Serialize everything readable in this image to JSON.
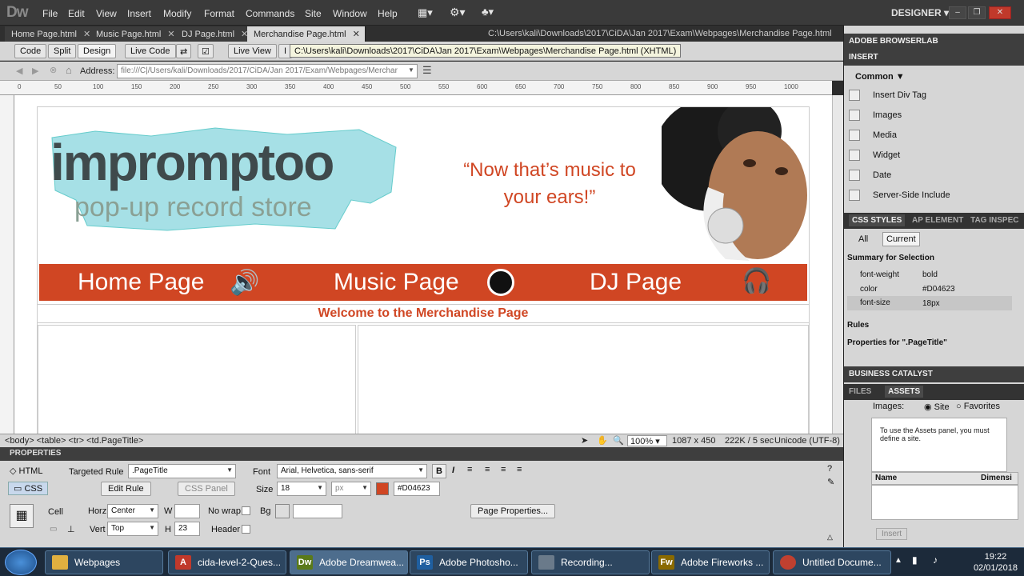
{
  "app": {
    "logo": "Dw",
    "workspace": "DESIGNER"
  },
  "menu": [
    "File",
    "Edit",
    "View",
    "Insert",
    "Modify",
    "Format",
    "Commands",
    "Site",
    "Window",
    "Help"
  ],
  "tabs": [
    {
      "label": "Home Page.html",
      "active": false
    },
    {
      "label": "Music Page.html",
      "active": false
    },
    {
      "label": "DJ Page.html",
      "active": false
    },
    {
      "label": "Merchandise Page.html",
      "active": true
    }
  ],
  "doc_path": "C:\\Users\\kali\\Downloads\\2017\\CiDA\\Jan 2017\\Exam\\Webpages\\Merchandise Page.html",
  "toolbar": {
    "code": "Code",
    "split": "Split",
    "design": "Design",
    "live_code": "Live Code",
    "live_view": "Live View",
    "inspect": "I"
  },
  "tooltip": "C:\\Users\\kali\\Downloads\\2017\\CiDA\\Jan 2017\\Exam\\Webpages\\Merchandise Page.html (XHTML)",
  "address": {
    "label": "Address:",
    "value": "file:///C|/Users/kali/Downloads/2017/CiDA/Jan 2017/Exam/Webpages/Merchar"
  },
  "ruler_ticks": [
    "0",
    "50",
    "100",
    "150",
    "200",
    "250",
    "300",
    "350",
    "400",
    "450",
    "500",
    "550",
    "600",
    "650",
    "700",
    "750",
    "800",
    "850",
    "900",
    "950",
    "1000"
  ],
  "webpage": {
    "logo_line1": "impromptoo",
    "logo_line2": "pop-up record store",
    "quote_line1": "“Now that’s music to",
    "quote_line2": "your ears!”",
    "nav": [
      "Home Page",
      "Music Page",
      "DJ Page"
    ],
    "welcome": "Welcome to the Merchandise Page"
  },
  "status": {
    "tags": "<body> <table> <tr> <td.PageTitle>",
    "zoom": "100%",
    "dims": "1087 x 450",
    "size": "222K / 5 sec",
    "encoding": "Unicode (UTF-8)"
  },
  "properties": {
    "title": "PROPERTIES",
    "html_btn": "HTML",
    "css_btn": "CSS",
    "targeted_rule_label": "Targeted Rule",
    "targeted_rule": ".PageTitle",
    "edit_rule": "Edit Rule",
    "css_panel": "CSS Panel",
    "font_label": "Font",
    "font": "Arial, Helvetica, sans-serif",
    "size_label": "Size",
    "size": "18",
    "unit": "px",
    "color": "#D04623",
    "cell_label": "Cell",
    "horz_label": "Horz",
    "horz": "Center",
    "vert_label": "Vert",
    "vert": "Top",
    "w_label": "W",
    "w": "",
    "h_label": "H",
    "h": "23",
    "nowrap_label": "No wrap",
    "bg_label": "Bg",
    "header_label": "Header",
    "page_properties": "Page Properties..."
  },
  "right_panel": {
    "browserlab": "ADOBE BROWSERLAB",
    "insert": "INSERT",
    "common": "Common",
    "insert_items": [
      "Insert Div Tag",
      "Images",
      "Media",
      "Widget",
      "Date",
      "Server-Side Include"
    ],
    "css_tabs": [
      "CSS STYLES",
      "AP ELEMENT",
      "TAG INSPEC"
    ],
    "css_modes": [
      "All",
      "Current"
    ],
    "summary": "Summary for Selection",
    "css_props": [
      {
        "name": "font-weight",
        "value": "bold"
      },
      {
        "name": "color",
        "value": "#D04623"
      },
      {
        "name": "font-size",
        "value": "18px"
      }
    ],
    "rules": "Rules",
    "properties_for": "Properties for \".PageTitle\"",
    "business_catalyst": "BUSINESS CATALYST",
    "files_tab": "FILES",
    "assets_tab": "ASSETS",
    "images_label": "Images:",
    "site_label": "Site",
    "favorites_label": "Favorites",
    "assets_msg": "To use the Assets panel, you must define a site.",
    "col_name": "Name",
    "col_dim": "Dimensi",
    "insert_btn": "Insert"
  },
  "taskbar": [
    {
      "label": "Webpages",
      "color": "#e0b040"
    },
    {
      "label": "cida-level-2-Ques...",
      "color": "#c0392b"
    },
    {
      "label": "Adobe Dreamwea...",
      "color": "#5a7a1a"
    },
    {
      "label": "Adobe Photosho...",
      "color": "#1f5fa0"
    },
    {
      "label": "Recording...",
      "color": "#6a7a8a"
    },
    {
      "label": "Adobe Fireworks ...",
      "color": "#8a6a00"
    },
    {
      "label": "Untitled Docume...",
      "color": "#c04030"
    }
  ],
  "clock": {
    "time": "19:22",
    "date": "02/01/2018"
  },
  "colors": {
    "accent": "#D04623"
  }
}
